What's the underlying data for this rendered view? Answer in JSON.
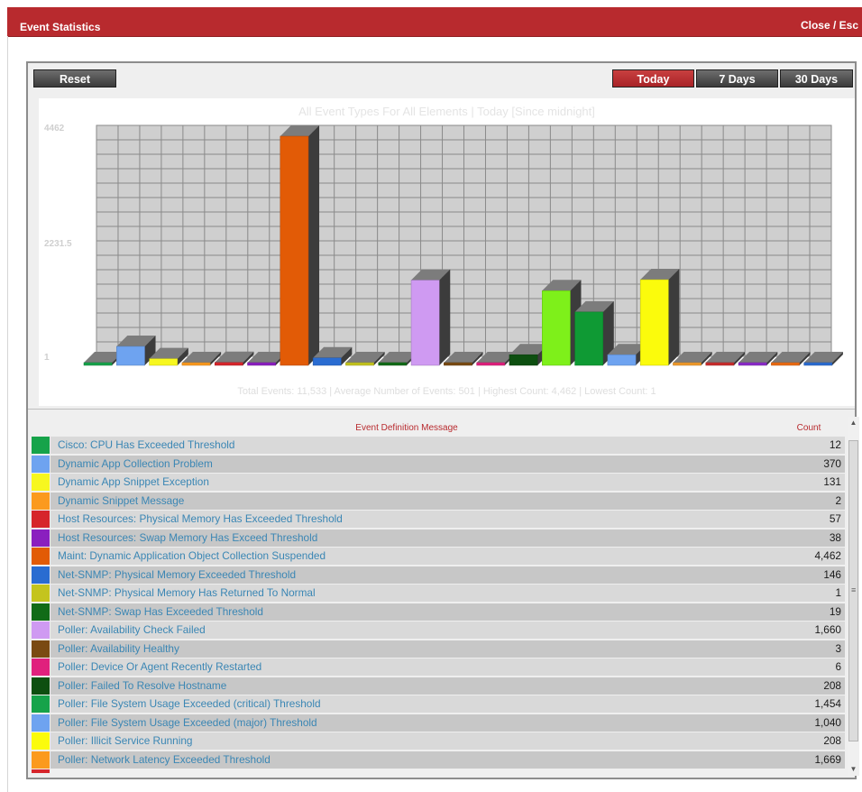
{
  "window": {
    "title": "Event Statistics",
    "close_label": "Close / Esc"
  },
  "toolbar": {
    "reset_label": "Reset",
    "ranges": [
      {
        "label": "Today",
        "active": true
      },
      {
        "label": "7 Days",
        "active": false
      },
      {
        "label": "30 Days",
        "active": false
      }
    ]
  },
  "chart_data": {
    "type": "bar",
    "title": "All Event Types For All Elements | Today [Since midnight]",
    "footer": "Total Events: 11,533 | Average Number of Events: 501 | Highest Count: 4,462 | Lowest Count: 1",
    "y_ticks": [
      "4462",
      "2231.5",
      "1"
    ],
    "ylim": [
      1,
      4462
    ],
    "grid": true,
    "categories": [
      "Cisco: CPU Has Exceeded Threshold",
      "Dynamic App Collection Problem",
      "Dynamic App Snippet Exception",
      "Dynamic Snippet Message",
      "Host Resources: Physical Memory Has Exceeded Threshold",
      "Host Resources: Swap Memory Has Exceed Threshold",
      "Maint: Dynamic Application Object Collection Suspended",
      "Net-SNMP: Physical Memory Exceeded Threshold",
      "Net-SNMP: Physical Memory Has Returned To Normal",
      "Net-SNMP: Swap Has Exceeded Threshold",
      "Poller: Availability Check Failed",
      "Poller: Availability Healthy",
      "Poller: Device Or Agent Recently Restarted",
      "Poller: Failed To Resolve Hostname",
      "Poller: File System Usage Exceeded (critical) Threshold",
      "Poller: File System Usage Exceeded (major) Threshold",
      "Poller: Illicit Service Running",
      "Poller: Network Latency Exceeded Threshold",
      "",
      "",
      "",
      "",
      ""
    ],
    "values": [
      12,
      370,
      131,
      2,
      57,
      38,
      4462,
      146,
      1,
      19,
      1660,
      3,
      6,
      208,
      1454,
      1040,
      208,
      1669,
      30,
      20,
      25,
      20,
      15
    ],
    "colors": [
      "#16a34a",
      "#6ea3f0",
      "#f7f71f",
      "#fb9a1e",
      "#d6252b",
      "#8a1fbf",
      "#e25b06",
      "#2a6cd1",
      "#c4c41e",
      "#116b17",
      "#cf9af2",
      "#7a4a12",
      "#e0207d",
      "#0d4f10",
      "#7ef01a",
      "#0f9a34",
      "#6ea3f0",
      "#fbfb0c",
      "#f09a2a",
      "#c82c2c",
      "#8a2ac8",
      "#ea6a12",
      "#2a6cd1"
    ]
  },
  "table": {
    "header_message": "Event Definition Message",
    "header_count": "Count",
    "rows": [
      {
        "message": "Cisco: CPU Has Exceeded Threshold",
        "count": "12",
        "color": "#16a34a"
      },
      {
        "message": "Dynamic App Collection Problem",
        "count": "370",
        "color": "#6ea3f0"
      },
      {
        "message": "Dynamic App Snippet Exception",
        "count": "131",
        "color": "#f7f71f"
      },
      {
        "message": "Dynamic Snippet Message",
        "count": "2",
        "color": "#fb9a1e"
      },
      {
        "message": "Host Resources: Physical Memory Has Exceeded Threshold",
        "count": "57",
        "color": "#d6252b"
      },
      {
        "message": "Host Resources: Swap Memory Has Exceed Threshold",
        "count": "38",
        "color": "#8a1fbf"
      },
      {
        "message": "Maint: Dynamic Application Object Collection Suspended",
        "count": "4,462",
        "color": "#e25b06"
      },
      {
        "message": "Net-SNMP: Physical Memory Exceeded Threshold",
        "count": "146",
        "color": "#2a6cd1"
      },
      {
        "message": "Net-SNMP: Physical Memory Has Returned To Normal",
        "count": "1",
        "color": "#c4c41e"
      },
      {
        "message": "Net-SNMP: Swap Has Exceeded Threshold",
        "count": "19",
        "color": "#116b17"
      },
      {
        "message": "Poller: Availability Check Failed",
        "count": "1,660",
        "color": "#cf9af2"
      },
      {
        "message": "Poller: Availability Healthy",
        "count": "3",
        "color": "#7a4a12"
      },
      {
        "message": "Poller: Device Or Agent Recently Restarted",
        "count": "6",
        "color": "#e0207d"
      },
      {
        "message": "Poller: Failed To Resolve Hostname",
        "count": "208",
        "color": "#0d4f10"
      },
      {
        "message": "Poller: File System Usage Exceeded (critical) Threshold",
        "count": "1,454",
        "color": "#16a34a"
      },
      {
        "message": "Poller: File System Usage Exceeded (major) Threshold",
        "count": "1,040",
        "color": "#6ea3f0"
      },
      {
        "message": "Poller: Illicit Service Running",
        "count": "208",
        "color": "#fbfb0c"
      },
      {
        "message": "Poller: Network Latency Exceeded Threshold",
        "count": "1,669",
        "color": "#fb9a1e"
      }
    ]
  },
  "scrollbar": {
    "up_icon": "▲",
    "down_icon": "▼",
    "grip_icon": "≡"
  }
}
